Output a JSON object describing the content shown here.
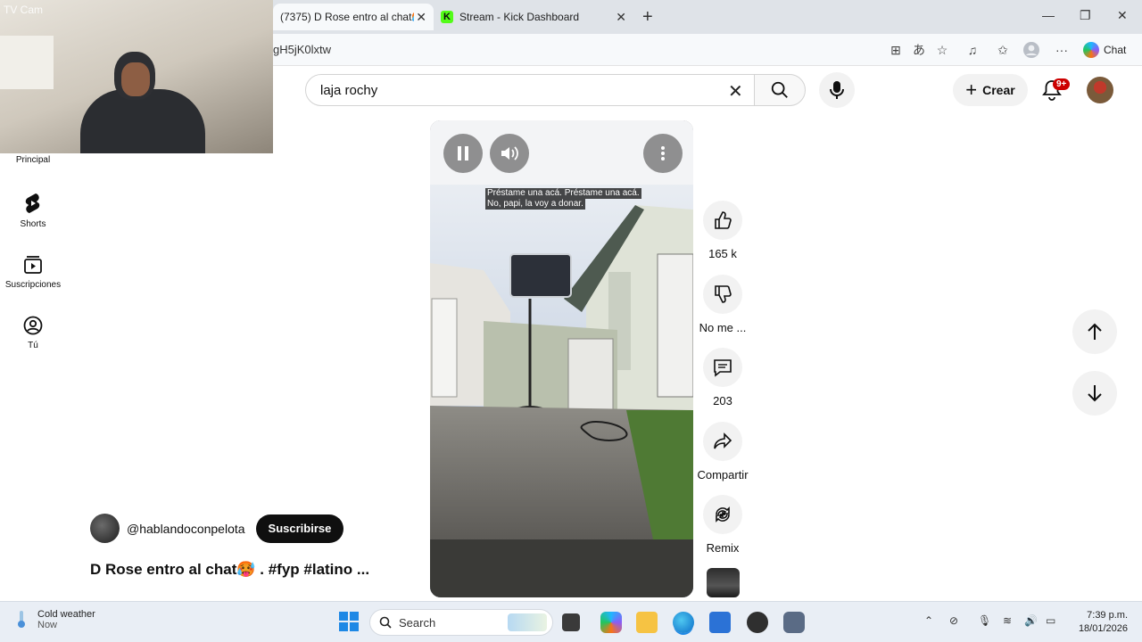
{
  "browser": {
    "tabs": [
      {
        "label": "(7375) D Rose entro al chat🥵",
        "active": true
      },
      {
        "label": "Stream - Kick Dashboard",
        "active": false
      }
    ],
    "url_fragment": "gH5jK0lxtw",
    "chat_label": "Chat"
  },
  "webcam": {
    "label": "TV Cam"
  },
  "youtube": {
    "search_query": "laja rochy",
    "create_label": "Crear",
    "notification_badge": "9+",
    "nav": [
      {
        "label": "Principal",
        "icon": "home-icon"
      },
      {
        "label": "Shorts",
        "icon": "shorts-icon"
      },
      {
        "label": "Suscripciones",
        "icon": "subscriptions-icon"
      },
      {
        "label": "Tú",
        "icon": "you-icon"
      }
    ],
    "short": {
      "caption_line1": "Préstame una acá. Préstame una acá.",
      "caption_line2": "No, papi, la voy a donar.",
      "channel": "@hablandoconpelota",
      "subscribe_label": "Suscribirse",
      "title": "D Rose entro al chat🥵 . #fyp #latino ..."
    },
    "actions": {
      "likes": "165 k",
      "dislike_label": "No me ...",
      "comments": "203",
      "share_label": "Compartir",
      "remix_label": "Remix"
    }
  },
  "taskbar": {
    "weather_title": "Cold weather",
    "weather_sub": "Now",
    "search_placeholder": "Search",
    "time": "7:39 p.m.",
    "date": "18/01/2026"
  }
}
